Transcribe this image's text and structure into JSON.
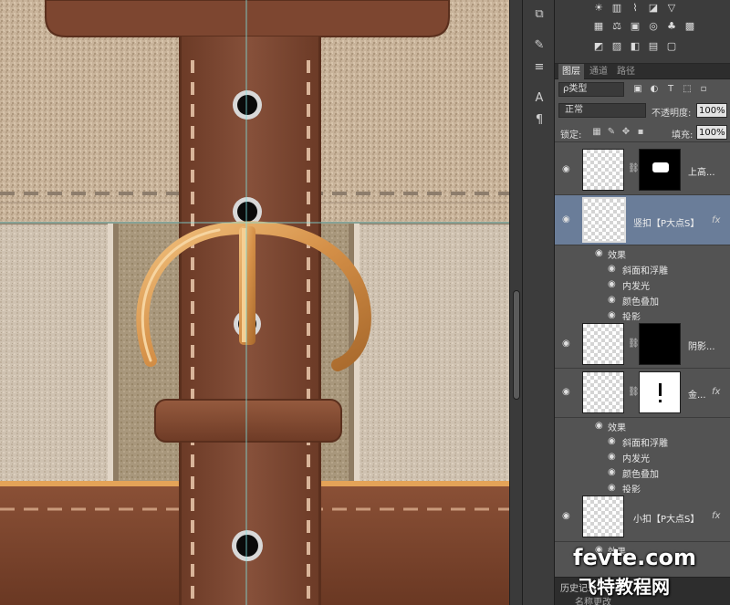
{
  "layers_panel": {
    "tabs": [
      "图层",
      "通道",
      "路径"
    ],
    "filter_kind": "ρ类型",
    "blend_mode": "正常",
    "opacity_label": "不透明度:",
    "opacity_value": "100%",
    "lock_label": "锁定:",
    "fill_label": "填充:",
    "fill_value": "100%",
    "layers": [
      {
        "name": "上高...",
        "has_mask": true,
        "fx": false,
        "selected": false
      },
      {
        "name": "竖扣【P大点S】",
        "has_mask": false,
        "fx": true,
        "selected": true,
        "effects_header": "效果",
        "effects": [
          "斜面和浮雕",
          "内发光",
          "颜色叠加",
          "投影"
        ]
      },
      {
        "name": "阴影...",
        "has_mask": true,
        "fx": false,
        "selected": false
      },
      {
        "name": "金...",
        "has_mask": true,
        "fx": true,
        "selected": false,
        "effects_header": "效果",
        "effects": [
          "斜面和浮雕",
          "内发光",
          "颜色叠加",
          "投影"
        ]
      },
      {
        "name": "小扣【P大点S】",
        "has_mask": false,
        "fx": true,
        "selected": false,
        "effects_header": "效果",
        "effects": []
      }
    ],
    "fx_symbol": "fx"
  },
  "history_panel": {
    "label": "历史记录",
    "partial_item": "名称更改"
  },
  "watermark": {
    "line1": "fevte.com",
    "line2": "飞特教程网"
  },
  "icons": {
    "eye": "eye-icon",
    "chain": "link-icon"
  },
  "colors": {
    "selection": "#6a7d99",
    "panel_bg": "#535353",
    "leather": "#7a4630",
    "buckle": "#d69a55"
  }
}
